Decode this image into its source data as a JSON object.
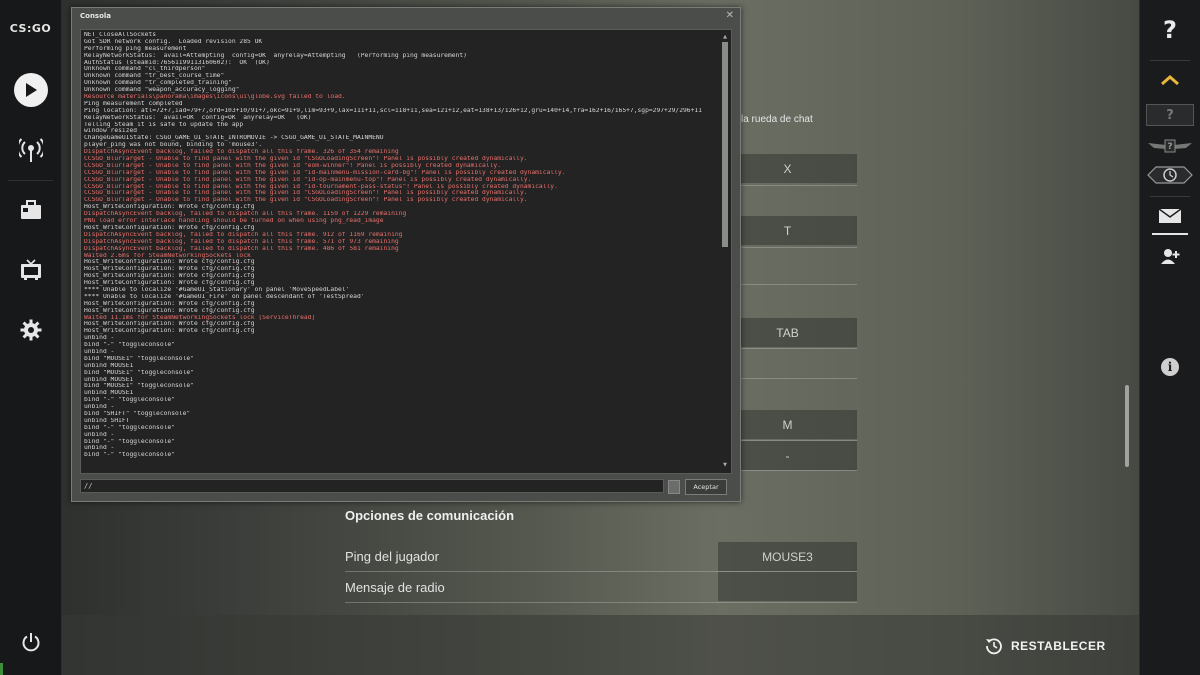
{
  "app": {
    "logo_text": "CS:GO"
  },
  "left_nav": [
    "play",
    "broadcast",
    "inventory",
    "watch",
    "settings",
    "power"
  ],
  "console": {
    "title": "Consola",
    "input_value": "//",
    "submit_label": "Aceptar",
    "lines": [
      {
        "text": "NET_CloseAllSockets",
        "type": "normal"
      },
      {
        "text": "Got SDR network config.  Loaded revision 285 OK",
        "type": "normal"
      },
      {
        "text": "Performing ping measurement",
        "type": "normal"
      },
      {
        "text": "RelayNetworkStatus:  avail=Attempting  config=OK  anyrelay=Attempting   (Performing ping measurement)",
        "type": "normal"
      },
      {
        "text": "AuthStatus (steamid:76561199113160602):  OK  (OK)",
        "type": "normal"
      },
      {
        "text": "Unknown command \"cl_thirdperson\"",
        "type": "normal"
      },
      {
        "text": "Unknown command \"tr_best_course_time\"",
        "type": "normal"
      },
      {
        "text": "Unknown command \"tr_completed_training\"",
        "type": "normal"
      },
      {
        "text": "Unknown command \"weapon_accuracy_logging\"",
        "type": "normal"
      },
      {
        "text": "Resource materials\\panorama\\images\\icons\\ui\\globe.svg failed to load.",
        "type": "error"
      },
      {
        "text": "Ping measurement completed",
        "type": "normal"
      },
      {
        "text": "Ping location: atl=72+7,iad=79+7,ord=103+10/91+7,okc=91+9,lim=93+9,lax=111+11,scl=118+11,sea=121+12,eat=138+13/126+12,gru=140+14,fra=162+16/165+7,sgp=297+29/296+11",
        "type": "normal"
      },
      {
        "text": "RelayNetworkStatus:  avail=OK  config=OK  anyrelay=OK   (OK)",
        "type": "normal"
      },
      {
        "text": "Telling Steam it is safe to update the app",
        "type": "normal"
      },
      {
        "text": "window resized",
        "type": "normal"
      },
      {
        "text": "ChangeGameUIState: CSGO_GAME_UI_STATE_INTROMOVIE -> CSGO_GAME_UI_STATE_MAINMENU",
        "type": "normal"
      },
      {
        "text": "player_ping was not bound, binding to 'mouse3'.",
        "type": "normal"
      },
      {
        "text": "DispatchAsyncEvent backlog, failed to dispatch all this frame. 326 of 354 remaining",
        "type": "error"
      },
      {
        "text": "CCSGO_BlurTarget - Unable to find panel with the given id \"CSGOLoadingScreen\"! Panel is possibly created dynamically.",
        "type": "error"
      },
      {
        "text": "CCSGO_BlurTarget - Unable to find panel with the given id \"eom-winner\"! Panel is possibly created dynamically.",
        "type": "error"
      },
      {
        "text": "CCSGO_BlurTarget - Unable to find panel with the given id \"id-mainmenu-mission-card-bg\"! Panel is possibly created dynamically.",
        "type": "error"
      },
      {
        "text": "CCSGO_BlurTarget - Unable to find panel with the given id \"id-op-mainmenu-top\"! Panel is possibly created dynamically.",
        "type": "error"
      },
      {
        "text": "CCSGO_BlurTarget - Unable to find panel with the given id \"id-tournament-pass-status\"! Panel is possibly created dynamically.",
        "type": "error"
      },
      {
        "text": "CCSGO_BlurTarget - Unable to find panel with the given id \"CSGOLoadingScreen\"! Panel is possibly created dynamically.",
        "type": "error"
      },
      {
        "text": "CCSGO_BlurTarget - Unable to find panel with the given id \"CSGOLoadingScreen\"! Panel is possibly created dynamically.",
        "type": "error"
      },
      {
        "text": "Host_WriteConfiguration: Wrote cfg/config.cfg",
        "type": "normal"
      },
      {
        "text": "DispatchAsyncEvent backlog, failed to dispatch all this frame. 1159 of 1229 remaining",
        "type": "error"
      },
      {
        "text": "PNG load error Interlace handling should be turned on when using png_read_image",
        "type": "error"
      },
      {
        "text": "Host_WriteConfiguration: Wrote cfg/config.cfg",
        "type": "normal"
      },
      {
        "text": "DispatchAsyncEvent backlog, failed to dispatch all this frame. 912 of 1169 remaining",
        "type": "error"
      },
      {
        "text": "DispatchAsyncEvent backlog, failed to dispatch all this frame. 571 of 973 remaining",
        "type": "error"
      },
      {
        "text": "DispatchAsyncEvent backlog, failed to dispatch all this frame. 486 of 581 remaining",
        "type": "error"
      },
      {
        "text": "Waited 2.6ms for SteamNetworkingSockets lock",
        "type": "error"
      },
      {
        "text": "Host_WriteConfiguration: Wrote cfg/config.cfg",
        "type": "normal"
      },
      {
        "text": "Host_WriteConfiguration: Wrote cfg/config.cfg",
        "type": "normal"
      },
      {
        "text": "Host_WriteConfiguration: Wrote cfg/config.cfg",
        "type": "normal"
      },
      {
        "text": "Host_WriteConfiguration: Wrote cfg/config.cfg",
        "type": "normal"
      },
      {
        "text": "**** Unable to localize '#GameUI_Stationary' on panel 'MoveSpeedLabel'",
        "type": "normal"
      },
      {
        "text": "**** Unable to localize '#GameUI_Fire' on panel descendant of 'TestSpread'",
        "type": "normal"
      },
      {
        "text": "Host_WriteConfiguration: Wrote cfg/config.cfg",
        "type": "normal"
      },
      {
        "text": "Host_WriteConfiguration: Wrote cfg/config.cfg",
        "type": "normal"
      },
      {
        "text": "Waited 11.1ms for SteamNetworkingSockets lock [ServiceThread]",
        "type": "error"
      },
      {
        "text": "Host_WriteConfiguration: Wrote cfg/config.cfg",
        "type": "normal"
      },
      {
        "text": "Host_WriteConfiguration: Wrote cfg/config.cfg",
        "type": "normal"
      },
      {
        "text": "unbind -",
        "type": "normal"
      },
      {
        "text": "bind \"-\" \"toggleconsole\"",
        "type": "normal"
      },
      {
        "text": "unbind -",
        "type": "normal"
      },
      {
        "text": "bind \"MOUSE1\" \"toggleconsole\"",
        "type": "normal"
      },
      {
        "text": "unbind MOUSE1",
        "type": "normal"
      },
      {
        "text": "bind \"MOUSE1\" \"toggleconsole\"",
        "type": "normal"
      },
      {
        "text": "unbind MOUSE1",
        "type": "normal"
      },
      {
        "text": "bind \"MOUSE1\" \"toggleconsole\"",
        "type": "normal"
      },
      {
        "text": "unbind MOUSE1",
        "type": "normal"
      },
      {
        "text": "bind \"-\" \"toggleconsole\"",
        "type": "normal"
      },
      {
        "text": "unbind -",
        "type": "normal"
      },
      {
        "text": "bind \"SHIFT\" \"toggleconsole\"",
        "type": "normal"
      },
      {
        "text": "unbind SHIFT",
        "type": "normal"
      },
      {
        "text": "bind \"-\" \"toggleconsole\"",
        "type": "normal"
      },
      {
        "text": "unbind -",
        "type": "normal"
      },
      {
        "text": "bind \"-\" \"toggleconsole\"",
        "type": "normal"
      },
      {
        "text": "unbind -",
        "type": "normal"
      },
      {
        "text": "bind \"-\" \"toggleconsole\"",
        "type": "normal"
      }
    ]
  },
  "settings": {
    "chat_wheel_label": "la rueda de chat",
    "key_cells": [
      "X",
      "T",
      "TAB",
      "M",
      "-"
    ],
    "communication_header": "Opciones de comunicación",
    "comm_rows": [
      {
        "label": "Ping del jugador",
        "key": "MOUSE3"
      },
      {
        "label": "Mensaje de radio",
        "key": ""
      }
    ]
  },
  "right_nav": {
    "help_label": "?",
    "rank_label": "?",
    "icons": [
      "help",
      "rank-up-chevron",
      "rank-unknown",
      "wings-rank",
      "clock-badge",
      "mail",
      "add-friend",
      "info"
    ]
  },
  "footer": {
    "reset_label": "RESTABLECER"
  },
  "colors": {
    "console_error": "#e8706b",
    "console_normal": "#d6d6d6",
    "sidebar_bg": "#171819"
  }
}
